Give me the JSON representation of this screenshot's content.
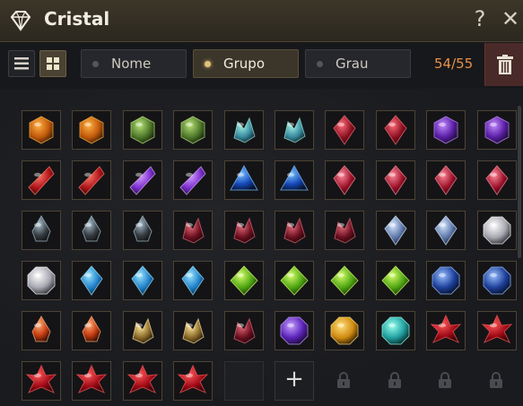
{
  "window": {
    "title": "Cristal",
    "title_icon": "diamond-icon",
    "help_label": "?",
    "close_label": "✕"
  },
  "toolbar": {
    "list_view_icon": "list-icon",
    "grid_view_icon": "grid-icon",
    "filters": [
      {
        "label": "Nome",
        "active": false
      },
      {
        "label": "Grupo",
        "active": true
      },
      {
        "label": "Grau",
        "active": false
      }
    ],
    "count": "54/55",
    "trash_icon": "trash-icon"
  },
  "inventory": {
    "add_label": "+",
    "rows": [
      [
        "amber-orange",
        "amber-orange",
        "olive-green",
        "olive-green",
        "teal-cluster",
        "teal-cluster",
        "ruby-red",
        "ruby-red",
        "amethyst-purple",
        "amethyst-purple"
      ],
      [
        "crimson-shard",
        "crimson-shard",
        "violet-shard",
        "violet-shard",
        "sapphire-blue",
        "sapphire-blue",
        "garnet-red",
        "garnet-red",
        "garnet-red",
        "garnet-red"
      ],
      [
        "dark-gray-drop",
        "dark-gray-drop",
        "dark-gray-drop",
        "dark-red-cluster",
        "dark-red-cluster",
        "dark-red-cluster",
        "dark-red-cluster",
        "pale-blue",
        "pale-blue",
        "white-diamond"
      ],
      [
        "white-diamond",
        "cyan-shard",
        "cyan-shard",
        "cyan-shard",
        "lime-green",
        "lime-green",
        "lime-green",
        "lime-green",
        "star-sapphire",
        "star-sapphire"
      ],
      [
        "orange-drop",
        "orange-drop",
        "gold-cluster",
        "gold-cluster",
        "dark-red-cluster",
        "violet-orb",
        "gold-orb",
        "aqua-round",
        "crimson-flower",
        "crimson-flower"
      ],
      [
        "crimson-flower",
        "crimson-flower",
        "crimson-flower",
        "crimson-flower",
        "empty",
        "add",
        "locked",
        "locked",
        "locked",
        "locked"
      ]
    ]
  }
}
